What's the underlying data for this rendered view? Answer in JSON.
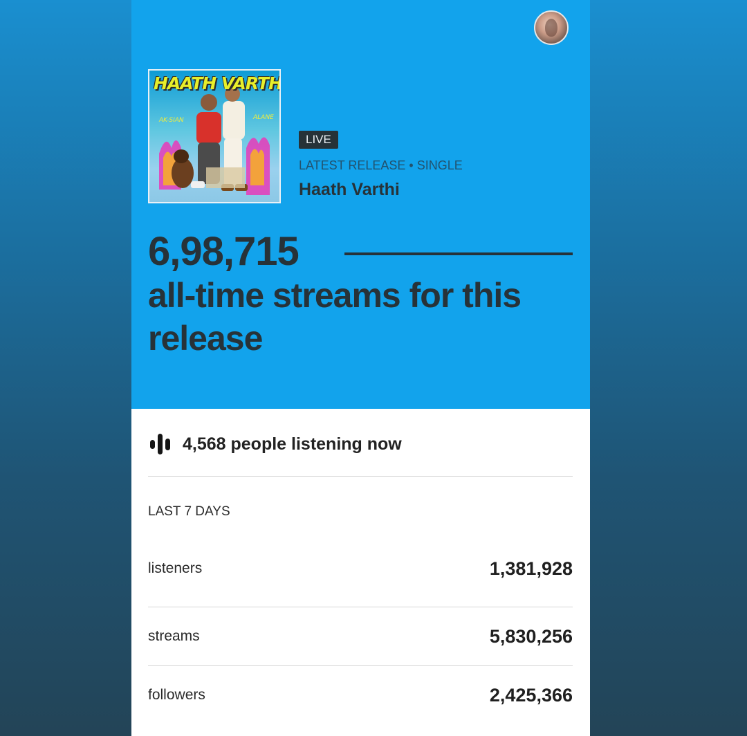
{
  "colors": {
    "hero_background": "#12a3ec",
    "text_dark": "#273238",
    "badge_background": "#263238",
    "card_background": "#ffffff"
  },
  "profile": {
    "avatar_icon": "profile-avatar"
  },
  "release": {
    "cover_title": "HAATH VARTHI",
    "badge": "LIVE",
    "meta": "LATEST RELEASE • SINGLE",
    "title": "Haath Varthi"
  },
  "streams": {
    "count": "6,98,715",
    "caption": "all-time streams for this release"
  },
  "listening_now": {
    "icon": "audio-bars-icon",
    "text": "4,568 people listening now"
  },
  "last_7_days": {
    "label": "LAST 7 DAYS",
    "stats": [
      {
        "label": "listeners",
        "value": "1,381,928"
      },
      {
        "label": "streams",
        "value": "5,830,256"
      },
      {
        "label": "followers",
        "value": "2,425,366"
      }
    ]
  }
}
